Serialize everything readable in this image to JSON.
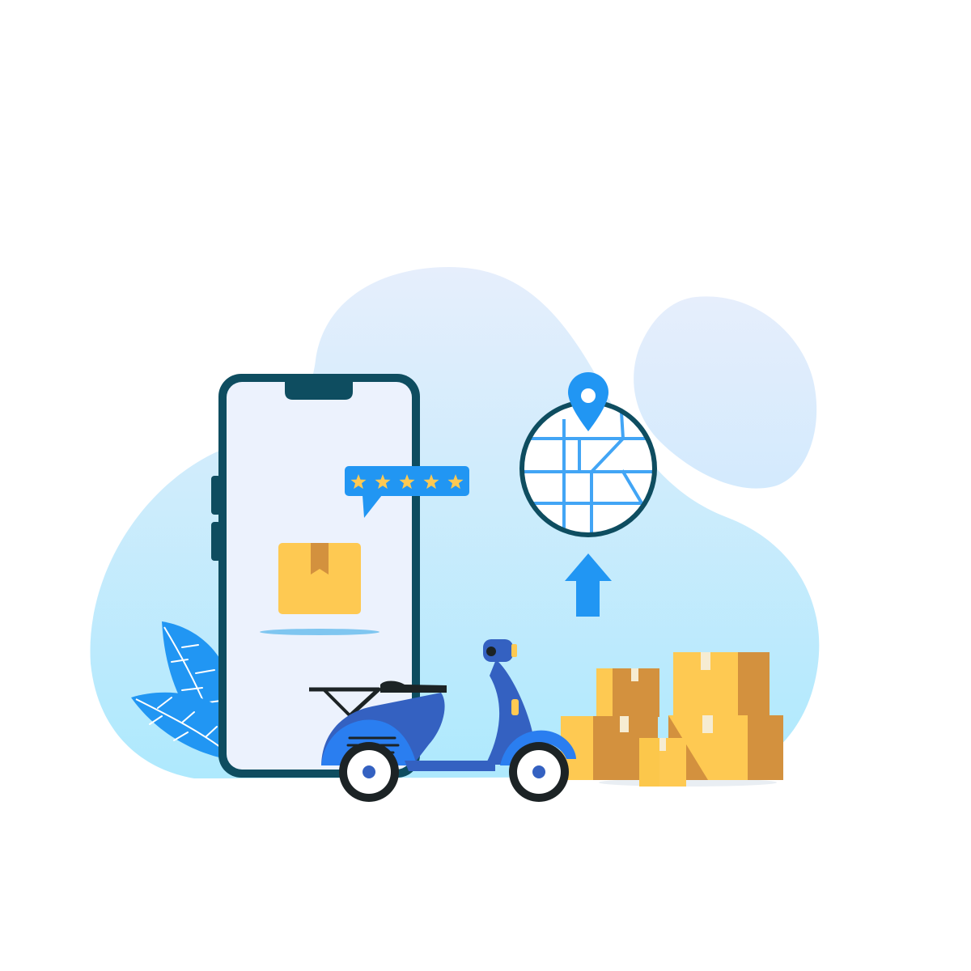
{
  "illustration": {
    "rating": {
      "star_count": 5,
      "filled_stars": 5
    },
    "colors": {
      "background": "#ffffff",
      "blob_top": "#e4eefc",
      "blob_bottom": "#aee8fd",
      "phone_frame": "#0e4d60",
      "phone_screen": "#ecf2fd",
      "accent_blue": "#2196f3",
      "scooter_dark": "#3461c1",
      "scooter_light": "#2a7ef0",
      "box_light": "#fec952",
      "box_dark": "#d3913e",
      "star": "#fec952",
      "tire": "#1c2325"
    },
    "icons": [
      "smartphone-icon",
      "package-icon",
      "rating-bubble-icon",
      "star-icon",
      "map-pin-icon",
      "globe-map-icon",
      "up-arrow-icon",
      "scooter-icon",
      "stacked-boxes-icon",
      "leaf-icon"
    ]
  }
}
